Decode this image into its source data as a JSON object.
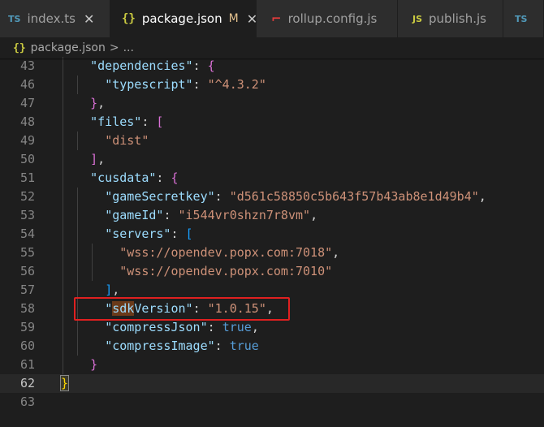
{
  "tabs": [
    {
      "label": "index.ts",
      "icon": "TS",
      "icon_name": "typescript-file-icon",
      "active": false,
      "modified": false,
      "close": "✕"
    },
    {
      "label": "package.json",
      "icon": "{}",
      "icon_name": "json-file-icon",
      "active": true,
      "modified": true,
      "modified_marker": "M",
      "close": "✕"
    },
    {
      "label": "rollup.config.js",
      "icon": "⌐",
      "icon_name": "rollup-file-icon",
      "active": false,
      "modified": false
    },
    {
      "label": "publish.js",
      "icon": "JS",
      "icon_name": "javascript-file-icon",
      "active": false,
      "modified": false
    },
    {
      "label": "",
      "icon": "TS",
      "icon_name": "typescript-file-icon",
      "active": false,
      "modified": false
    }
  ],
  "breadcrumb": {
    "icon": "{}",
    "file": "package.json",
    "separator": ">",
    "more": "..."
  },
  "editor": {
    "current_line": "62",
    "lines": [
      {
        "num": "43",
        "tokens": [
          [
            "    ",
            "p"
          ],
          [
            "\"dependencies\"",
            "k"
          ],
          [
            ": ",
            "p"
          ],
          [
            "{",
            "b2"
          ]
        ]
      },
      {
        "num": "46",
        "tokens": [
          [
            "      ",
            "p"
          ],
          [
            "\"typescript\"",
            "k"
          ],
          [
            ": ",
            "p"
          ],
          [
            "\"^4.3.2\"",
            "s"
          ]
        ]
      },
      {
        "num": "47",
        "tokens": [
          [
            "    ",
            "p"
          ],
          [
            "}",
            "b2"
          ],
          [
            ",",
            "p"
          ]
        ]
      },
      {
        "num": "48",
        "tokens": [
          [
            "    ",
            "p"
          ],
          [
            "\"files\"",
            "k"
          ],
          [
            ": ",
            "p"
          ],
          [
            "[",
            "b2"
          ]
        ]
      },
      {
        "num": "49",
        "tokens": [
          [
            "      ",
            "p"
          ],
          [
            "\"dist\"",
            "s"
          ]
        ]
      },
      {
        "num": "50",
        "tokens": [
          [
            "    ",
            "p"
          ],
          [
            "]",
            "b2"
          ],
          [
            ",",
            "p"
          ]
        ]
      },
      {
        "num": "51",
        "tokens": [
          [
            "    ",
            "p"
          ],
          [
            "\"cusdata\"",
            "k"
          ],
          [
            ": ",
            "p"
          ],
          [
            "{",
            "b2"
          ]
        ]
      },
      {
        "num": "52",
        "tokens": [
          [
            "      ",
            "p"
          ],
          [
            "\"gameSecretkey\"",
            "k"
          ],
          [
            ": ",
            "p"
          ],
          [
            "\"d561c58850c5b643f57b43ab8e1d49b4\"",
            "s"
          ],
          [
            ",",
            "p"
          ]
        ]
      },
      {
        "num": "53",
        "tokens": [
          [
            "      ",
            "p"
          ],
          [
            "\"gameId\"",
            "k"
          ],
          [
            ": ",
            "p"
          ],
          [
            "\"i544vr0shzn7r8vm\"",
            "s"
          ],
          [
            ",",
            "p"
          ]
        ]
      },
      {
        "num": "54",
        "tokens": [
          [
            "      ",
            "p"
          ],
          [
            "\"servers\"",
            "k"
          ],
          [
            ": ",
            "p"
          ],
          [
            "[",
            "b3"
          ]
        ]
      },
      {
        "num": "55",
        "tokens": [
          [
            "        ",
            "p"
          ],
          [
            "\"wss://opendev.popx.com:7018\"",
            "s"
          ],
          [
            ",",
            "p"
          ]
        ]
      },
      {
        "num": "56",
        "tokens": [
          [
            "        ",
            "p"
          ],
          [
            "\"wss://opendev.popx.com:7010\"",
            "s"
          ]
        ]
      },
      {
        "num": "57",
        "tokens": [
          [
            "      ",
            "p"
          ],
          [
            "]",
            "b3"
          ],
          [
            ",",
            "p"
          ]
        ]
      },
      {
        "num": "58",
        "tokens": [
          [
            "      ",
            "p"
          ],
          [
            "\"",
            "k"
          ],
          [
            "sdk",
            "k hl"
          ],
          [
            "Version\"",
            "k"
          ],
          [
            ": ",
            "p"
          ],
          [
            "\"1.0.15\"",
            "s"
          ],
          [
            ",",
            "p"
          ]
        ]
      },
      {
        "num": "59",
        "tokens": [
          [
            "      ",
            "p"
          ],
          [
            "\"compressJson\"",
            "k"
          ],
          [
            ": ",
            "p"
          ],
          [
            "true",
            "n"
          ],
          [
            ",",
            "p"
          ]
        ]
      },
      {
        "num": "60",
        "tokens": [
          [
            "      ",
            "p"
          ],
          [
            "\"compressImage\"",
            "k"
          ],
          [
            ": ",
            "p"
          ],
          [
            "true",
            "n"
          ]
        ]
      },
      {
        "num": "61",
        "tokens": [
          [
            "    ",
            "p"
          ],
          [
            "}",
            "b2"
          ]
        ]
      },
      {
        "num": "62",
        "tokens": [
          [
            "",
            "p"
          ],
          [
            "}",
            "b1 bm"
          ]
        ]
      },
      {
        "num": "63",
        "tokens": []
      }
    ]
  },
  "colors": {
    "editor_bg": "#1e1e1e",
    "key": "#9cdcfe",
    "string": "#ce9178",
    "bool": "#569cd6",
    "highlight_border": "#e02020"
  }
}
